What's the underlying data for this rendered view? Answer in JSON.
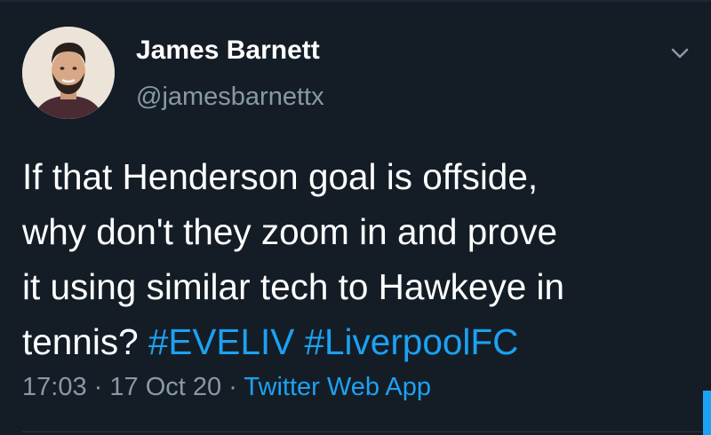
{
  "author": {
    "display_name": "James Barnett",
    "handle": "@jamesbarnettx"
  },
  "tweet": {
    "lines": [
      "If that Henderson goal is offside,",
      "why don't they zoom in and prove",
      "it using similar tech to Hawkeye in",
      "tennis?"
    ],
    "hashtags": [
      "#EVELIV",
      "#LiverpoolFC"
    ]
  },
  "meta": {
    "time": "17:03",
    "separator": "·",
    "date": "17 Oct 20",
    "source": "Twitter Web App"
  },
  "icons": {
    "menu": "chevron-down-icon",
    "avatar": "avatar"
  },
  "colors": {
    "background": "#141d26",
    "link": "#1da1f2",
    "secondary_text": "#8899a6",
    "primary_text": "#ffffff"
  }
}
